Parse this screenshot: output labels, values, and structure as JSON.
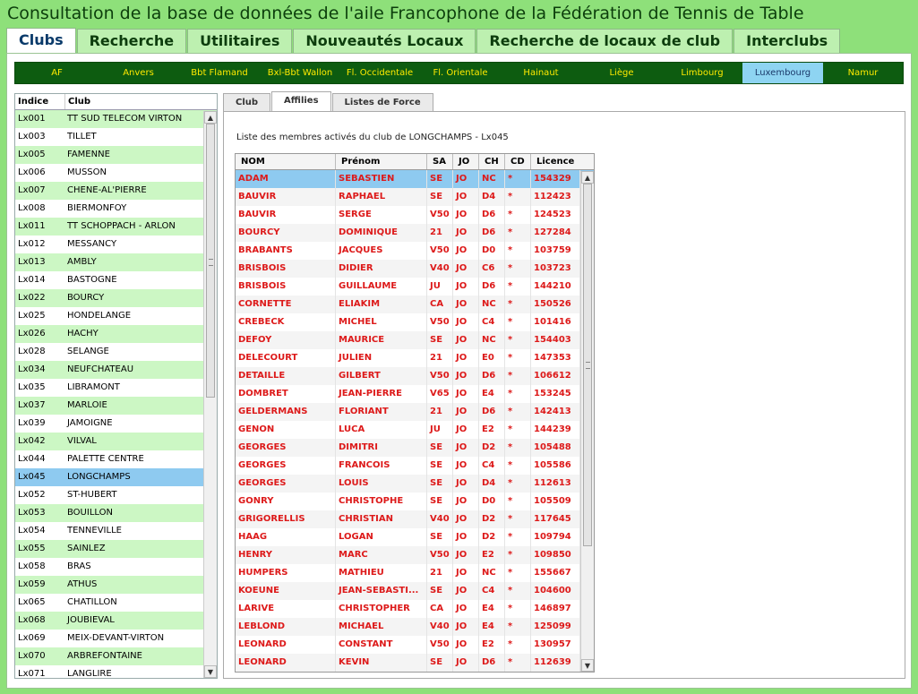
{
  "title": "Consultation de la base de données de l'aile Francophone de la Fédération de Tennis de Table",
  "main_tabs": [
    "Clubs",
    "Recherche",
    "Utilitaires",
    "Nouveautés Locaux",
    "Recherche de locaux de club",
    "Interclubs"
  ],
  "provinces": [
    "AF",
    "Anvers",
    "Bbt Flamand",
    "Bxl-Bbt Wallon",
    "Fl. Occidentale",
    "Fl. Orientale",
    "Hainaut",
    "Liège",
    "Limbourg",
    "Luxembourg",
    "Namur"
  ],
  "club_list": {
    "headers": [
      "Indice",
      "Club"
    ],
    "rows": [
      [
        "Lx001",
        "TT SUD TELECOM VIRTON"
      ],
      [
        "Lx003",
        "TILLET"
      ],
      [
        "Lx005",
        "FAMENNE"
      ],
      [
        "Lx006",
        "MUSSON"
      ],
      [
        "Lx007",
        "CHENE-AL'PIERRE"
      ],
      [
        "Lx008",
        "BIERMONFOY"
      ],
      [
        "Lx011",
        "TT SCHOPPACH - ARLON"
      ],
      [
        "Lx012",
        "MESSANCY"
      ],
      [
        "Lx013",
        "AMBLY"
      ],
      [
        "Lx014",
        "BASTOGNE"
      ],
      [
        "Lx022",
        "BOURCY"
      ],
      [
        "Lx025",
        "HONDELANGE"
      ],
      [
        "Lx026",
        "HACHY"
      ],
      [
        "Lx028",
        "SELANGE"
      ],
      [
        "Lx034",
        "NEUFCHATEAU"
      ],
      [
        "Lx035",
        "LIBRAMONT"
      ],
      [
        "Lx037",
        "MARLOIE"
      ],
      [
        "Lx039",
        "JAMOIGNE"
      ],
      [
        "Lx042",
        "VILVAL"
      ],
      [
        "Lx044",
        "PALETTE CENTRE"
      ],
      [
        "Lx045",
        "LONGCHAMPS"
      ],
      [
        "Lx052",
        "ST-HUBERT"
      ],
      [
        "Lx053",
        "BOUILLON"
      ],
      [
        "Lx054",
        "TENNEVILLE"
      ],
      [
        "Lx055",
        "SAINLEZ"
      ],
      [
        "Lx058",
        "BRAS"
      ],
      [
        "Lx059",
        "ATHUS"
      ],
      [
        "Lx065",
        "CHATILLON"
      ],
      [
        "Lx068",
        "JOUBIEVAL"
      ],
      [
        "Lx069",
        "MEIX-DEVANT-VIRTON"
      ],
      [
        "Lx070",
        "ARBREFONTAINE"
      ],
      [
        "Lx071",
        "LANGLIRE"
      ]
    ]
  },
  "sub_tabs": [
    "Club",
    "Affilies",
    "Listes de Force"
  ],
  "members_caption": "Liste des membres activés du club de LONGCHAMPS - Lx045",
  "members": {
    "headers": [
      "NOM",
      "Prénom",
      "SA",
      "JO",
      "CH",
      "CD",
      "Licence"
    ],
    "rows": [
      [
        "ADAM",
        "SEBASTIEN",
        "SE",
        "JO",
        "NC",
        "*",
        "154329"
      ],
      [
        "BAUVIR",
        "RAPHAEL",
        "SE",
        "JO",
        "D4",
        "*",
        "112423"
      ],
      [
        "BAUVIR",
        "SERGE",
        "V50",
        "JO",
        "D6",
        "*",
        "124523"
      ],
      [
        "BOURCY",
        "DOMINIQUE",
        "21",
        "JO",
        "D6",
        "*",
        "127284"
      ],
      [
        "BRABANTS",
        "JACQUES",
        "V50",
        "JO",
        "D0",
        "*",
        "103759"
      ],
      [
        "BRISBOIS",
        "DIDIER",
        "V40",
        "JO",
        "C6",
        "*",
        "103723"
      ],
      [
        "BRISBOIS",
        "GUILLAUME",
        "JU",
        "JO",
        "D6",
        "*",
        "144210"
      ],
      [
        "CORNETTE",
        "ELIAKIM",
        "CA",
        "JO",
        "NC",
        "*",
        "150526"
      ],
      [
        "CREBECK",
        "MICHEL",
        "V50",
        "JO",
        "C4",
        "*",
        "101416"
      ],
      [
        "DEFOY",
        "MAURICE",
        "SE",
        "JO",
        "NC",
        "*",
        "154403"
      ],
      [
        "DELECOURT",
        "JULIEN",
        "21",
        "JO",
        "E0",
        "*",
        "147353"
      ],
      [
        "DETAILLE",
        "GILBERT",
        "V50",
        "JO",
        "D6",
        "*",
        "106612"
      ],
      [
        "DOMBRET",
        "JEAN-PIERRE",
        "V65",
        "JO",
        "E4",
        "*",
        "153245"
      ],
      [
        "GELDERMANS",
        "FLORIANT",
        "21",
        "JO",
        "D6",
        "*",
        "142413"
      ],
      [
        "GENON",
        "LUCA",
        "JU",
        "JO",
        "E2",
        "*",
        "144239"
      ],
      [
        "GEORGES",
        "DIMITRI",
        "SE",
        "JO",
        "D2",
        "*",
        "105488"
      ],
      [
        "GEORGES",
        "FRANCOIS",
        "SE",
        "JO",
        "C4",
        "*",
        "105586"
      ],
      [
        "GEORGES",
        "LOUIS",
        "SE",
        "JO",
        "D4",
        "*",
        "112613"
      ],
      [
        "GONRY",
        "CHRISTOPHE",
        "SE",
        "JO",
        "D0",
        "*",
        "105509"
      ],
      [
        "GRIGORELLIS",
        "CHRISTIAN",
        "V40",
        "JO",
        "D2",
        "*",
        "117645"
      ],
      [
        "HAAG",
        "LOGAN",
        "SE",
        "JO",
        "D2",
        "*",
        "109794"
      ],
      [
        "HENRY",
        "MARC",
        "V50",
        "JO",
        "E2",
        "*",
        "109850"
      ],
      [
        "HUMPERS",
        "MATHIEU",
        "21",
        "JO",
        "NC",
        "*",
        "155667"
      ],
      [
        "KOEUNE",
        "JEAN-SEBASTI...",
        "SE",
        "JO",
        "C4",
        "*",
        "104600"
      ],
      [
        "LARIVE",
        "CHRISTOPHER",
        "CA",
        "JO",
        "E4",
        "*",
        "146897"
      ],
      [
        "LEBLOND",
        "MICHAEL",
        "V40",
        "JO",
        "E4",
        "*",
        "125099"
      ],
      [
        "LEONARD",
        "CONSTANT",
        "V50",
        "JO",
        "E2",
        "*",
        "130957"
      ],
      [
        "LEONARD",
        "KEVIN",
        "SE",
        "JO",
        "D6",
        "*",
        "112639"
      ]
    ]
  },
  "icons": [
    "scroll-up-arrow-icon",
    "scroll-down-arrow-icon"
  ],
  "colors": {
    "background": "#8ee07a",
    "province_bar": "#0d5c10",
    "province_text": "#ffea00",
    "selected": "#8ecaf0",
    "alt_row": "#ccf7c4",
    "member_text": "#dd1a1a"
  }
}
